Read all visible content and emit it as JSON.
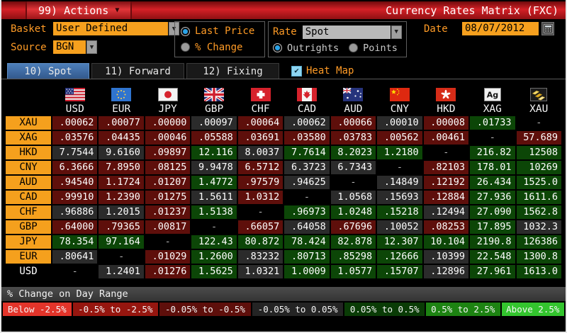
{
  "titlebar": {
    "actions_label": "99) Actions",
    "title": "Currency Rates Matrix (FXC)"
  },
  "controls": {
    "basket_label": "Basket",
    "basket_value": "User Defined",
    "source_label": "Source",
    "source_value": "BGN",
    "price_mode": {
      "options": [
        "Last Price",
        "% Change"
      ],
      "selected": "Last Price"
    },
    "rate_label": "Rate",
    "rate_value": "Spot",
    "rate_mode": {
      "options": [
        "Outrights",
        "Points"
      ],
      "selected": "Outrights"
    },
    "date_label": "Date",
    "date_value": "08/07/2012",
    "calendar_icon": "calendar-icon"
  },
  "tabs": [
    {
      "label": "10) Spot",
      "selected": true
    },
    {
      "label": "11) Forward",
      "selected": false
    },
    {
      "label": "12) Fixing",
      "selected": false
    }
  ],
  "heatmap": {
    "label": "Heat Map",
    "checked": true
  },
  "matrix": {
    "columns": [
      {
        "code": "USD",
        "icon": "us-flag-icon"
      },
      {
        "code": "EUR",
        "icon": "eu-flag-icon"
      },
      {
        "code": "JPY",
        "icon": "jp-flag-icon"
      },
      {
        "code": "GBP",
        "icon": "gb-flag-icon"
      },
      {
        "code": "CHF",
        "icon": "ch-flag-icon"
      },
      {
        "code": "CAD",
        "icon": "ca-flag-icon"
      },
      {
        "code": "AUD",
        "icon": "au-flag-icon"
      },
      {
        "code": "CNY",
        "icon": "cn-flag-icon"
      },
      {
        "code": "HKD",
        "icon": "hk-flag-icon"
      },
      {
        "code": "XAG",
        "icon": "silver-icon"
      },
      {
        "code": "XAU",
        "icon": "gold-icon"
      }
    ],
    "rows": [
      {
        "label": "XAU",
        "values": [
          ".00062",
          ".00077",
          ".00000",
          ".00097",
          ".00064",
          ".00062",
          ".00066",
          ".00010",
          ".00008",
          ".01733",
          "-"
        ],
        "colors": "rrrnrnrnrgd"
      },
      {
        "label": "XAG",
        "values": [
          ".03576",
          ".04435",
          ".00046",
          ".05588",
          ".03691",
          ".03580",
          ".03783",
          ".00562",
          ".00461",
          "-",
          "57.689"
        ],
        "colors": "rrrrrrrrrdr"
      },
      {
        "label": "HKD",
        "values": [
          "7.7544",
          "9.6160",
          ".09897",
          "12.116",
          "8.0037",
          "7.7614",
          "8.2023",
          "1.2180",
          "-",
          "216.82",
          "12508"
        ],
        "colors": "nnrgngggdgg"
      },
      {
        "label": "CNY",
        "values": [
          "6.3666",
          "7.8950",
          ".08125",
          "9.9478",
          "6.5712",
          "6.3723",
          "6.7343",
          "-",
          ".82103",
          "178.01",
          "10269"
        ],
        "colors": "rrrnrnndrgg"
      },
      {
        "label": "AUD",
        "values": [
          ".94540",
          "1.1724",
          ".01207",
          "1.4772",
          ".97579",
          ".94625",
          "-",
          ".14849",
          ".12192",
          "26.434",
          "1525.0"
        ],
        "colors": "rrrgrndnrgg"
      },
      {
        "label": "CAD",
        "values": [
          ".99910",
          "1.2390",
          ".01275",
          "1.5611",
          "1.0312",
          "-",
          "1.0568",
          ".15693",
          ".12884",
          "27.936",
          "1611.6"
        ],
        "colors": "rrrnrdnnrgg"
      },
      {
        "label": "CHF",
        "values": [
          ".96886",
          "1.2015",
          ".01237",
          "1.5138",
          "-",
          ".96973",
          "1.0248",
          ".15218",
          ".12494",
          "27.090",
          "1562.8"
        ],
        "colors": "nnrgdgggngg"
      },
      {
        "label": "GBP",
        "values": [
          ".64000",
          ".79365",
          ".00817",
          "-",
          ".66057",
          ".64058",
          ".67696",
          ".10052",
          ".08253",
          "17.895",
          "1032.3"
        ],
        "colors": "rrrdrnrnrgn"
      },
      {
        "label": "JPY",
        "values": [
          "78.354",
          "97.164",
          "-",
          "122.43",
          "80.872",
          "78.424",
          "82.878",
          "12.307",
          "10.104",
          "2190.8",
          "126386"
        ],
        "colors": "ggdgggggggg"
      },
      {
        "label": "EUR",
        "values": [
          ".80641",
          "-",
          ".01029",
          "1.2600",
          ".83232",
          ".80713",
          ".85298",
          ".12666",
          ".10399",
          "22.548",
          "1300.8"
        ],
        "colors": "ndrgngggngg"
      },
      {
        "label": "USD",
        "values": [
          "-",
          "1.2401",
          ".01276",
          "1.5625",
          "1.0321",
          "1.0009",
          "1.0577",
          ".15707",
          ".12896",
          "27.961",
          "1613.0"
        ],
        "colors": "dnrgngggngg"
      }
    ],
    "heat_colors": {
      "r": "#5e0f0b",
      "n": "#2b2b2b",
      "g": "#0c4607",
      "d": "#000000"
    },
    "row_label_bg": "#f5a01d"
  },
  "footer": {
    "title": "% Change on Day Range",
    "legend": [
      {
        "label": "Below -2.5%",
        "color": "#e2342a"
      },
      {
        "label": "-0.5% to -2.5%",
        "color": "#96160f"
      },
      {
        "label": "-0.05% to -0.5%",
        "color": "#5e0f0b"
      },
      {
        "label": "-0.05% to 0.05%",
        "color": "#242424"
      },
      {
        "label": "0.05% to 0.5%",
        "color": "#0a3c06"
      },
      {
        "label": "0.5% to 2.5%",
        "color": "#1d8312"
      },
      {
        "label": "Above 2.5%",
        "color": "#33c42e"
      }
    ]
  }
}
